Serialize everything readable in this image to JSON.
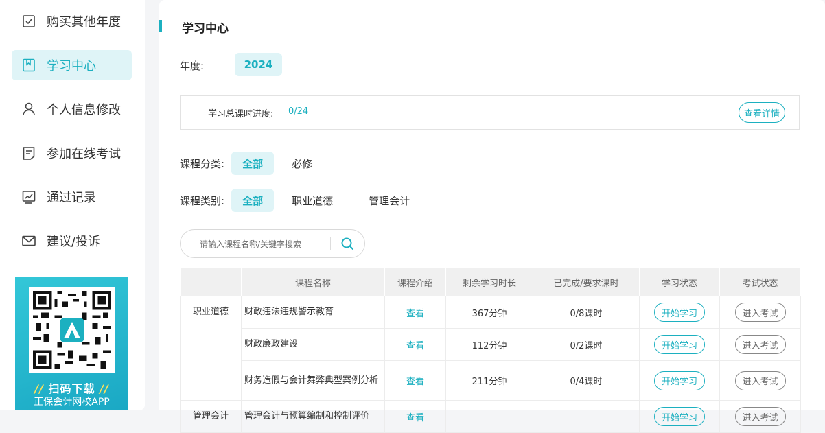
{
  "sidebar": {
    "items": [
      {
        "label": "购买其他年度",
        "icon": "checkbox-icon"
      },
      {
        "label": "学习中心",
        "icon": "bookmark-icon",
        "active": true
      },
      {
        "label": "个人信息修改",
        "icon": "user-icon"
      },
      {
        "label": "参加在线考试",
        "icon": "document-icon"
      },
      {
        "label": "通过记录",
        "icon": "chart-icon"
      },
      {
        "label": "建议/投诉",
        "icon": "mail-icon"
      }
    ],
    "promo": {
      "title": "扫码下载",
      "subtitle": "正保会计网校APP"
    }
  },
  "main": {
    "title": "学习中心",
    "year_label": "年度:",
    "year_value": "2024",
    "progress": {
      "label": "学习总课时进度:",
      "value": "0/24",
      "detail_button": "查看详情"
    },
    "category_filter": {
      "label": "课程分类:",
      "options": [
        "全部",
        "必修"
      ],
      "selected": "全部"
    },
    "type_filter": {
      "label": "课程类别:",
      "options": [
        "全部",
        "职业道德",
        "管理会计"
      ],
      "selected": "全部"
    },
    "search": {
      "placeholder": "请输入课程名称/关键字搜索"
    },
    "table": {
      "headers": [
        "",
        "课程名称",
        "课程介绍",
        "剩余学习时长",
        "已完成/要求课时",
        "学习状态",
        "考试状态"
      ],
      "groups": [
        {
          "category": "职业道德",
          "rows": [
            {
              "name": "财政违法违规警示教育",
              "intro": "查看",
              "remaining": "367分钟",
              "progress": "0/8课时",
              "study": "开始学习",
              "exam": "进入考试"
            },
            {
              "name": "财政廉政建设",
              "intro": "查看",
              "remaining": "112分钟",
              "progress": "0/2课时",
              "study": "开始学习",
              "exam": "进入考试"
            },
            {
              "name": "财务造假与会计舞弊典型案例分析",
              "intro": "查看",
              "remaining": "211分钟",
              "progress": "0/4课时",
              "study": "开始学习",
              "exam": "进入考试"
            }
          ]
        },
        {
          "category": "管理会计",
          "rows": [
            {
              "name": "管理会计与预算编制和控制评价",
              "intro": "查看",
              "remaining": "",
              "progress": "",
              "study": "开始学习",
              "exam": "进入考试"
            }
          ]
        }
      ]
    }
  },
  "colors": {
    "accent": "#1cb0c0",
    "accent_bg": "#dff4f7"
  }
}
